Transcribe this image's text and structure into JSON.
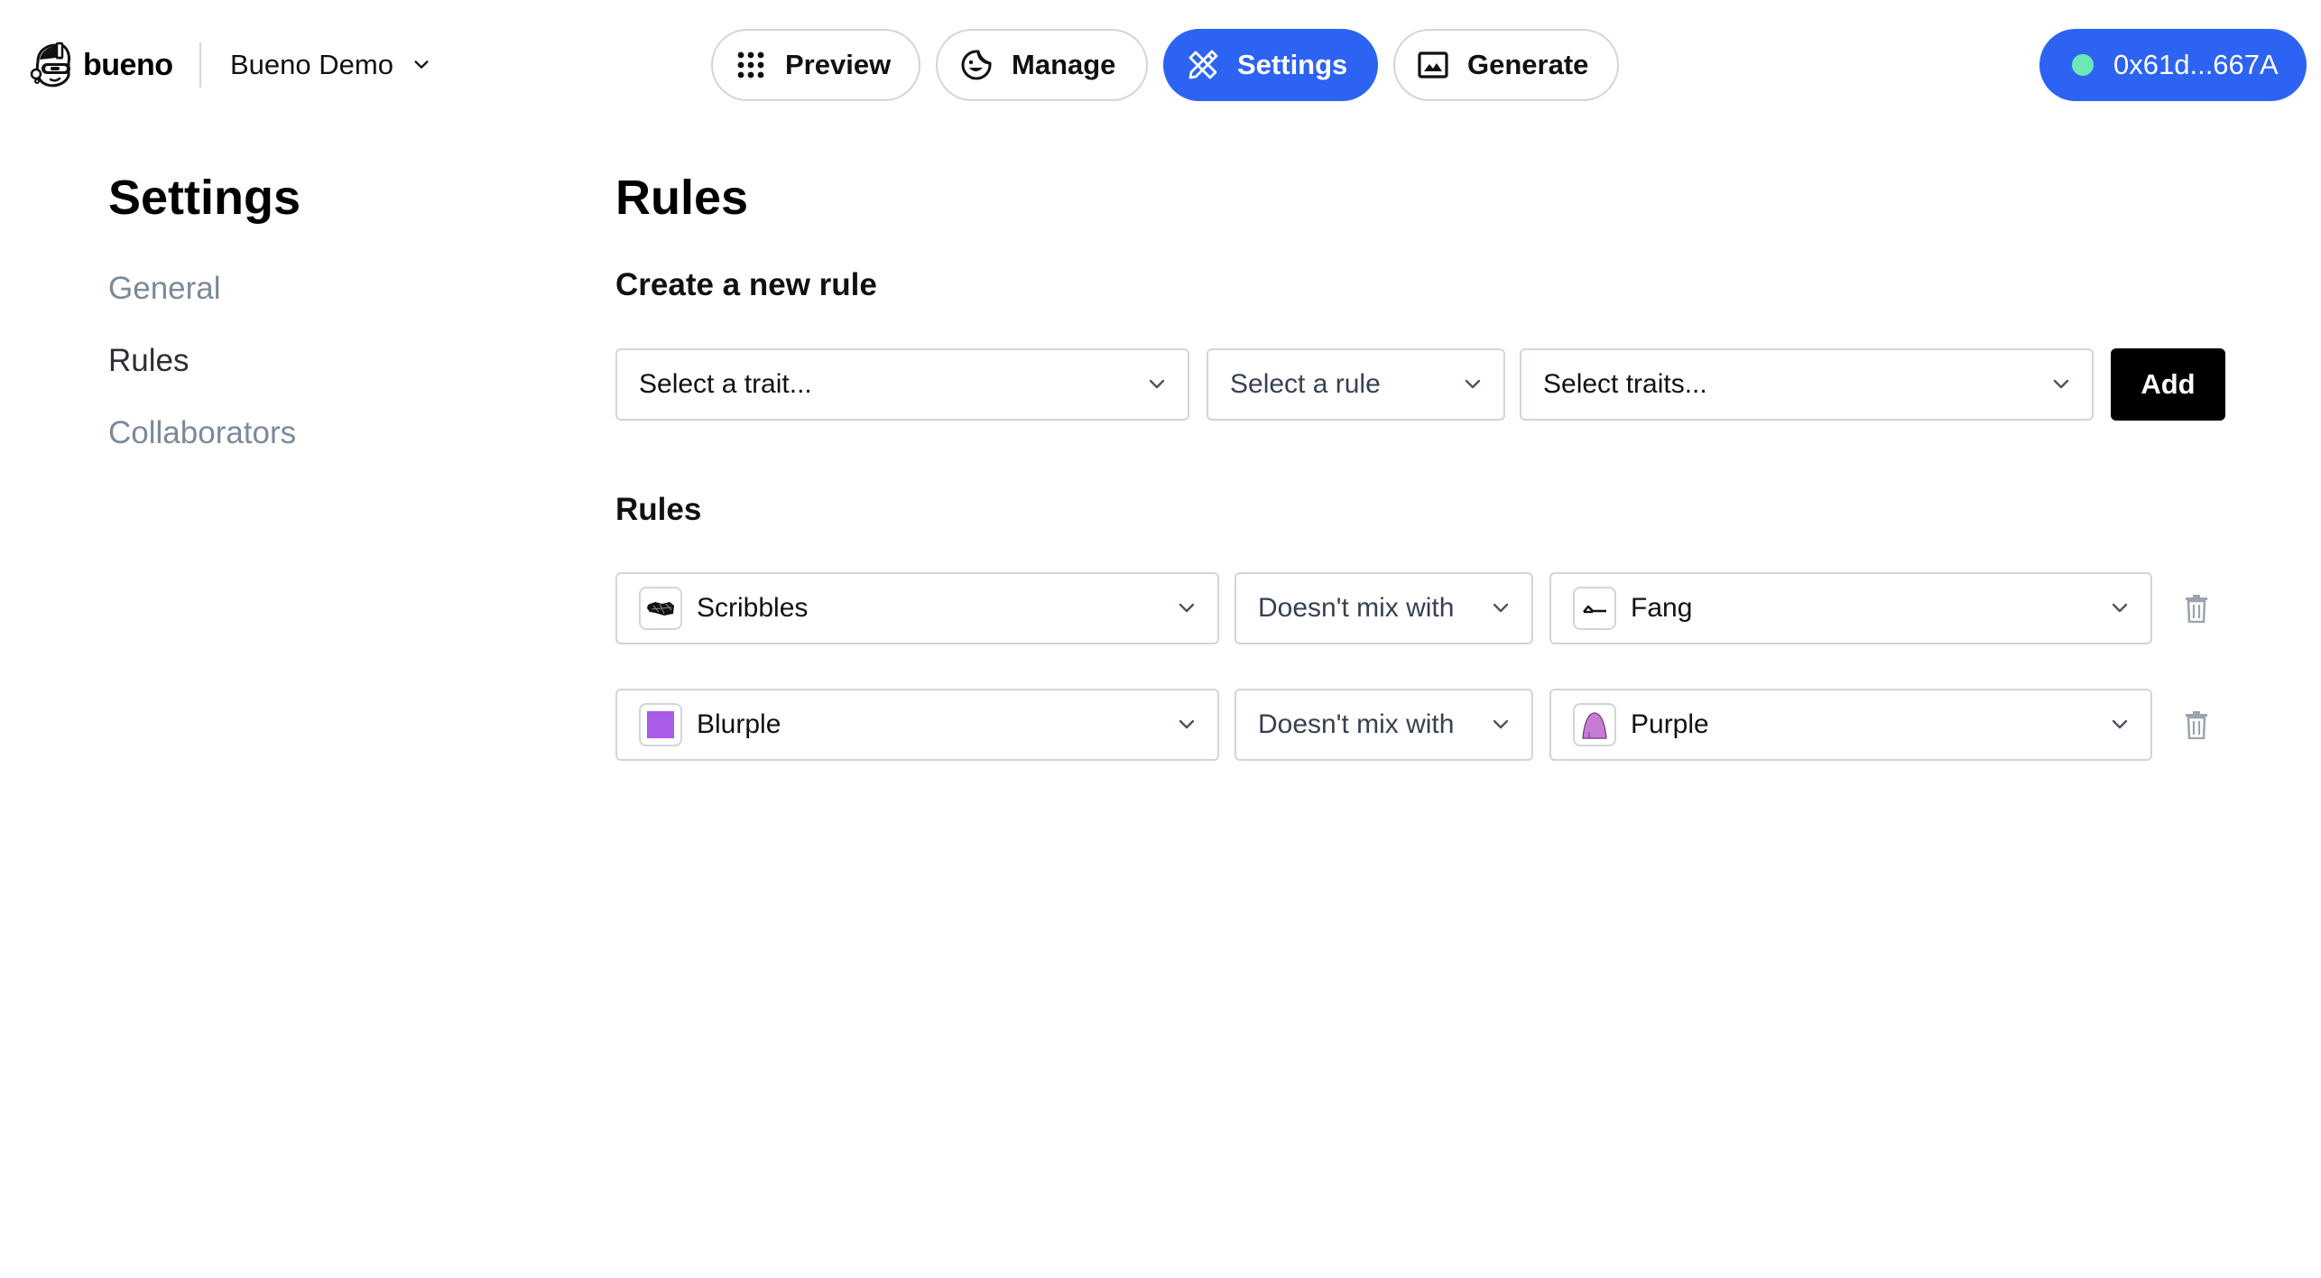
{
  "header": {
    "logo_text": "bueno",
    "project_name": "Bueno Demo",
    "nav": [
      {
        "label": "Preview",
        "icon": "grid-dots-icon",
        "active": false
      },
      {
        "label": "Manage",
        "icon": "sticker-smile-icon",
        "active": false
      },
      {
        "label": "Settings",
        "icon": "ruler-pencil-icon",
        "active": true
      },
      {
        "label": "Generate",
        "icon": "image-icon",
        "active": false
      }
    ],
    "wallet": {
      "address": "0x61d...667A",
      "status_color": "#6ee7b7"
    }
  },
  "sidebar": {
    "title": "Settings",
    "items": [
      {
        "label": "General",
        "active": false
      },
      {
        "label": "Rules",
        "active": true
      },
      {
        "label": "Collaborators",
        "active": false
      }
    ]
  },
  "main": {
    "title": "Rules",
    "create_section": {
      "title": "Create a new rule",
      "trait_placeholder": "Select a trait...",
      "rule_placeholder": "Select a rule",
      "traits_placeholder": "Select traits...",
      "add_label": "Add"
    },
    "rules_section": {
      "title": "Rules",
      "rules": [
        {
          "trait": "Scribbles",
          "trait_icon": "scribbles-thumbnail",
          "rule": "Doesn't mix with",
          "target": "Fang",
          "target_icon": "fang-thumbnail"
        },
        {
          "trait": "Blurple",
          "trait_icon": "blurple-swatch",
          "trait_color": "#a95ce8",
          "rule": "Doesn't mix with",
          "target": "Purple",
          "target_icon": "purple-hair-thumbnail",
          "target_color": "#c77bd6"
        }
      ]
    }
  },
  "colors": {
    "accent": "#2d63f2",
    "sidebar_inactive": "#7b8a99",
    "border": "#d1d5db"
  }
}
